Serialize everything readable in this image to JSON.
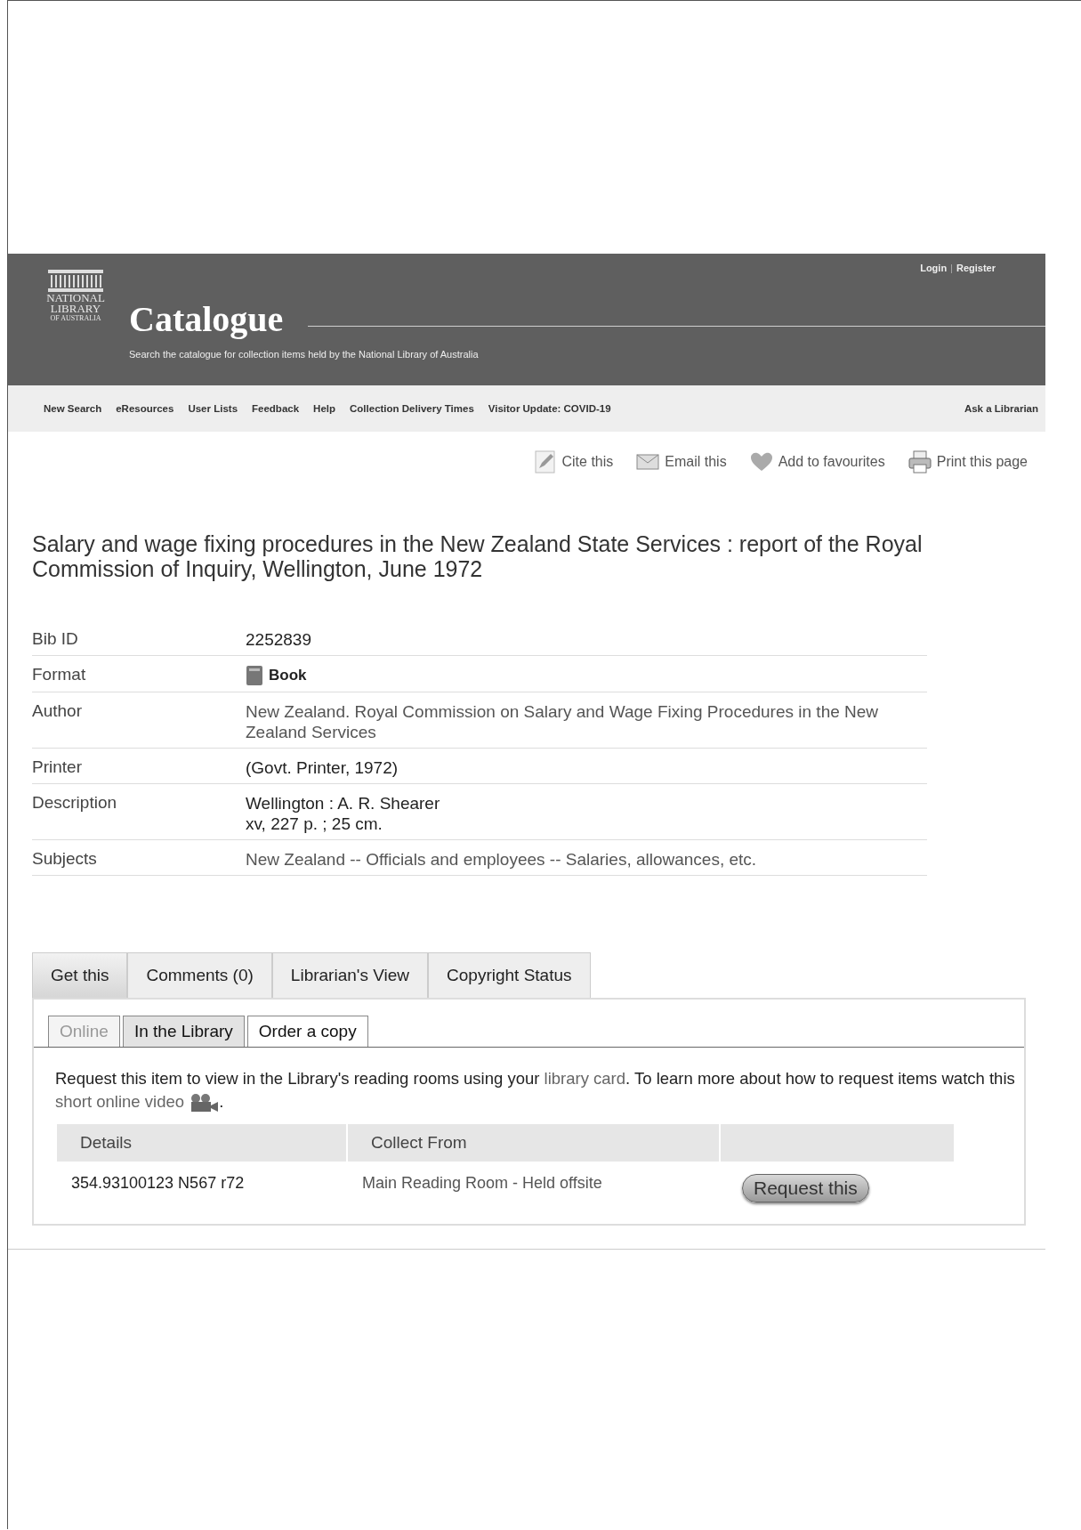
{
  "header": {
    "logo_lines": [
      "NATIONAL",
      "LIBRARY",
      "OF AUSTRALIA"
    ],
    "title": "Catalogue",
    "subtitle": "Search the catalogue for collection items held by the National Library of Australia",
    "account_links": [
      "Login",
      "Register"
    ],
    "account_separator": "|"
  },
  "nav": {
    "items": [
      "New Search",
      "eResources",
      "User Lists",
      "Feedback",
      "Help",
      "Collection Delivery Times",
      "Visitor Update: COVID-19"
    ],
    "right": "Ask a Librarian"
  },
  "actions": [
    {
      "kind": "cite",
      "label": "Cite this"
    },
    {
      "kind": "email",
      "label": "Email this"
    },
    {
      "kind": "favourite",
      "label": "Add to favourites"
    },
    {
      "kind": "print",
      "label": "Print this page"
    }
  ],
  "record_title": "Salary and wage fixing procedures in the New Zealand State Services : report of the Royal Commission of Inquiry, Wellington, June 1972",
  "fields": [
    {
      "label": "Bib ID",
      "kind": "text",
      "lines": [
        "2252839"
      ]
    },
    {
      "label": "Format",
      "kind": "format",
      "lines": [
        "Book"
      ]
    },
    {
      "label": "Author",
      "kind": "link",
      "lines": [
        "New Zealand. Royal Commission on Salary and Wage Fixing Procedures in the New Zealand Services"
      ]
    },
    {
      "label": "Printer",
      "kind": "text",
      "lines": [
        "(Govt. Printer, 1972)"
      ]
    },
    {
      "label": "Description",
      "kind": "text",
      "lines": [
        "Wellington : A. R. Shearer",
        "xv, 227 p. ; 25 cm."
      ]
    },
    {
      "label": "Subjects",
      "kind": "link",
      "lines": [
        "New Zealand -- Officials and employees -- Salaries, allowances, etc."
      ]
    }
  ],
  "tabs": [
    {
      "label": "Get this",
      "selected": true
    },
    {
      "label": "Comments (0)",
      "selected": false
    },
    {
      "label": "Librarian's View",
      "selected": false
    },
    {
      "label": "Copyright Status",
      "selected": false
    }
  ],
  "subtabs": [
    {
      "label": "Online",
      "selected": false,
      "disabled": true
    },
    {
      "label": "In the Library",
      "selected": true,
      "disabled": false
    },
    {
      "label": "Order a copy",
      "selected": false,
      "disabled": false
    }
  ],
  "intro": {
    "before": "Request this item to view in the Library's reading rooms using your",
    "link1": "library card",
    "middle": ". To learn more about how to request items watch this",
    "link2": "short online video",
    "after": "."
  },
  "holdings": {
    "columns": [
      "Details",
      "Collect From"
    ],
    "rows": [
      {
        "details": "354.93100123 N567 r72",
        "collect_from": "Main Reading Room - Held offsite",
        "button": "Request this"
      }
    ]
  }
}
